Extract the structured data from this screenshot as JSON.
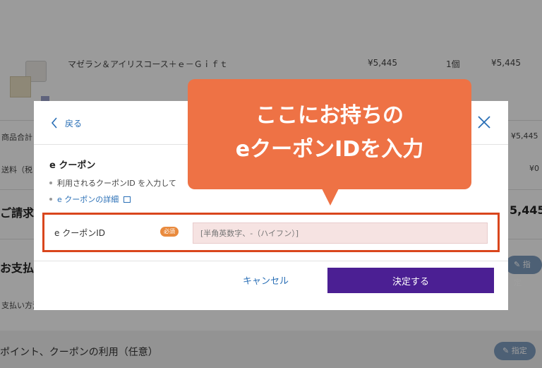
{
  "background": {
    "product_name": "マゼラン＆アイリスコース＋ｅ－Ｇｉｆｔ",
    "product_price": "¥5,445",
    "product_qty": "1個",
    "product_subtotal": "¥5,445",
    "subtotal_label": "商品合計",
    "subtotal_value": "¥5,445",
    "shipping_label": "送料（税",
    "shipping_value": "¥0",
    "billing_label": "ご請求金",
    "billing_value": "5,445",
    "payment_label": "お支払い",
    "payment_method_label": "支払い方法",
    "designate_label": "指定",
    "points_label": "ポイント、クーポンの利用（任意）",
    "designate_label_2": "指定"
  },
  "modal": {
    "back_label": "戻る",
    "section_title": "e クーポン",
    "note_text": "利用されるクーポンID を入力して",
    "detail_link": "e クーポンの詳細",
    "field_label": "e クーポンID",
    "required_badge": "必須",
    "input_placeholder": "[半角英数字、-（ハイフン）]",
    "input_value": "",
    "cancel_label": "キャンセル",
    "confirm_label": "決定する"
  },
  "callout": {
    "line1": "ここにお持ちの",
    "line2": "eクーポンIDを入力"
  },
  "colors": {
    "accent_purple": "#4b1f93",
    "callout_orange": "#ee7245",
    "highlight_border": "#d9461d",
    "link_blue": "#2a6fb6"
  }
}
